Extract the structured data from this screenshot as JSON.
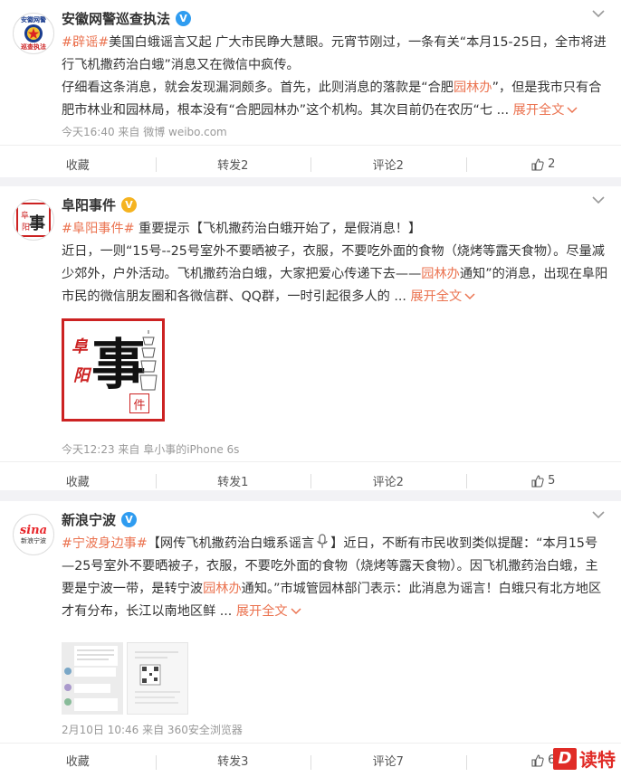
{
  "posts": [
    {
      "user": "安徽网警巡查执法",
      "verified_color": "#f5b320",
      "avatar_text_top": "安徽网警",
      "avatar_text_bottom": "巡查执法",
      "text_parts": {
        "tag": "#辟谣#",
        "p1": "美国白蛾谣言又起 广大市民睁大慧眼。元宵节刚过，一条有关“本月15-25日，全市将进行飞机撒药治白蛾”消息又在微信中疯传。",
        "p2a": "仔细看这条消息，就会发现漏洞颇多。首先，此则消息的落款是“合肥",
        "link1": "园林办",
        "p2b": "”，但是我市只有合肥市林业和园林局，根本没有“合肥园林办”这个机构。其次目前仍在农历“七",
        "expand": "展开全文"
      },
      "meta": "今天16:40 来自 微博 weibo.com",
      "actions": {
        "collect": "收藏",
        "repost": "转发2",
        "comment": "评论2",
        "like": "2"
      }
    },
    {
      "user": "阜阳事件",
      "verified_color": "#f5b320",
      "avatar_text": "阜阳事件",
      "text_parts": {
        "tag": "#阜阳事件#",
        "p1": "重要提示【飞机撒药治白蛾开始了，是假消息！】",
        "p2a": "近日，一则“15号--25号室外不要晒被子，衣服，不要吃外面的食物（烧烤等露天食物）。尽量减少郊外，户外活动。飞机撒药治白蛾，大家把爱心传递下去——",
        "link1": "园林办",
        "p2b": "通知”的消息，出现在阜阳市民的微信朋友圈和各微信群、QQ群，一时引起很多人的",
        "expand": "展开全文"
      },
      "image_text": {
        "c1": "阜",
        "c2": "阳",
        "big": "事",
        "c3": "件"
      },
      "meta": "今天12:23 来自 阜小事的iPhone 6s",
      "actions": {
        "collect": "收藏",
        "repost": "转发1",
        "comment": "评论2",
        "like": "5"
      }
    },
    {
      "user": "新浪宁波",
      "verified_color": "#2f9cf0",
      "avatar_text_top": "sina",
      "avatar_text_bottom": "新浪宁波",
      "text_parts": {
        "tag": "#宁波身边事#",
        "p1": "【网传飞机撒药治白蛾系谣言",
        "p1b": "】近日，不断有市民收到类似提醒：“本月15号—25号室外不要晒被子，衣服，不要吃外面的食物（烧烤等露天食物）。因飞机撒药治白蛾，主要是宁波一带，是转宁波",
        "link1": "园林办",
        "p2b": "通知。”市城管园林部门表示：此消息为谣言！白蛾只有北方地区才有分布，长江以南地区鲜",
        "expand": "展开全文"
      },
      "meta": "2月10日 10:46 来自 360安全浏览器",
      "actions": {
        "collect": "收藏",
        "repost": "转发3",
        "comment": "评论7",
        "like": "6"
      }
    }
  ],
  "watermark": "读特",
  "watermark_d": "D"
}
